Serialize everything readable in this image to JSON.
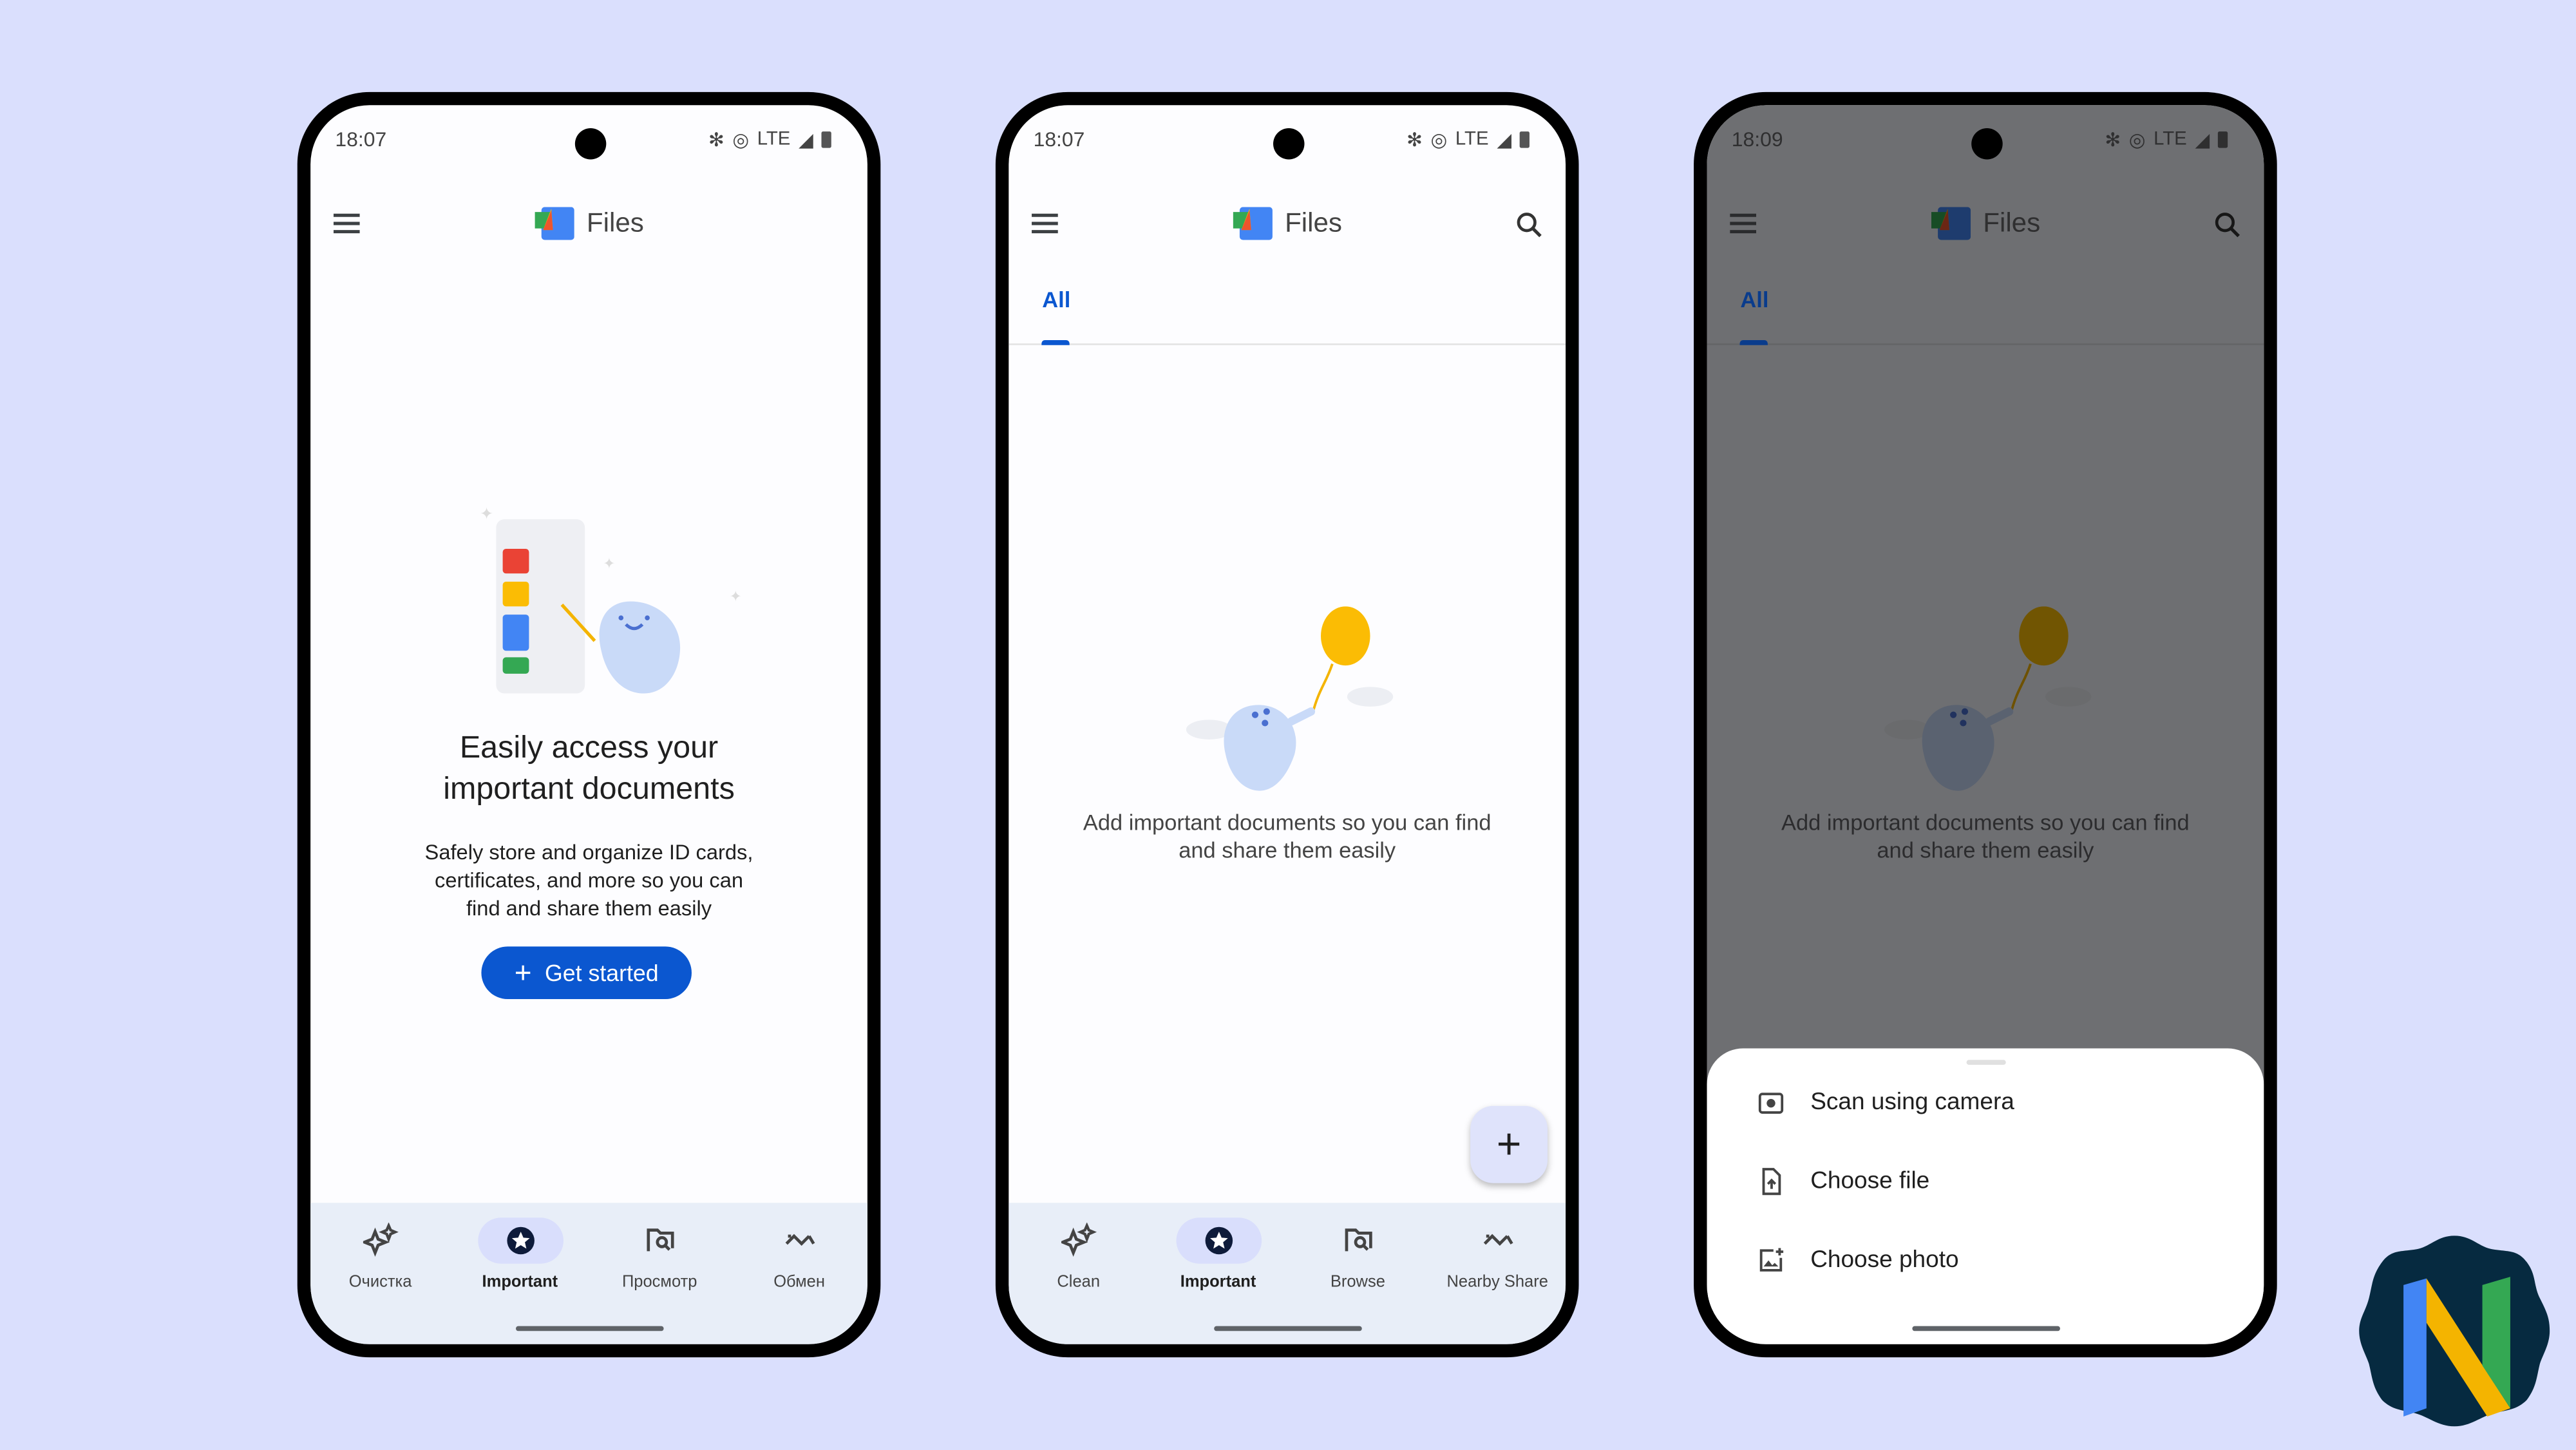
{
  "colors": {
    "background": "#dadffd",
    "accent": "#0b57d0",
    "nav_bg": "#e8eef8",
    "active_pill": "#d9defc",
    "badge_bg": "#062a40"
  },
  "phones": [
    {
      "status": {
        "time": "18:07",
        "network": "LTE"
      },
      "app_title": "Files",
      "empty": {
        "title_line1": "Easily access your",
        "title_line2": "important documents",
        "body_line1": "Safely store and organize ID cards,",
        "body_line2": "certificates, and more so you can",
        "body_line3": "find and share them easily"
      },
      "get_started": "Get started",
      "nav": [
        {
          "label": "Очистка",
          "icon": "sparkle-icon"
        },
        {
          "label": "Important",
          "icon": "star-icon",
          "active": true
        },
        {
          "label": "Просмотр",
          "icon": "folder-search-icon"
        },
        {
          "label": "Обмен",
          "icon": "nearby-share-icon"
        }
      ]
    },
    {
      "status": {
        "time": "18:07",
        "network": "LTE"
      },
      "app_title": "Files",
      "tab": "All",
      "empty": {
        "line1": "Add important documents so you can find",
        "line2": "and share them easily"
      },
      "fab": "+",
      "nav": [
        {
          "label": "Clean",
          "icon": "sparkle-icon"
        },
        {
          "label": "Important",
          "icon": "star-icon",
          "active": true
        },
        {
          "label": "Browse",
          "icon": "folder-search-icon"
        },
        {
          "label": "Nearby Share",
          "icon": "nearby-share-icon"
        }
      ]
    },
    {
      "status": {
        "time": "18:09",
        "network": "LTE"
      },
      "app_title": "Files",
      "tab": "All",
      "empty": {
        "line1": "Add important documents so you can find",
        "line2": "and share them easily"
      },
      "sheet": [
        {
          "label": "Scan using camera",
          "icon": "camera-icon"
        },
        {
          "label": "Choose file",
          "icon": "file-upload-icon"
        },
        {
          "label": "Choose photo",
          "icon": "add-photo-icon"
        }
      ]
    }
  ]
}
